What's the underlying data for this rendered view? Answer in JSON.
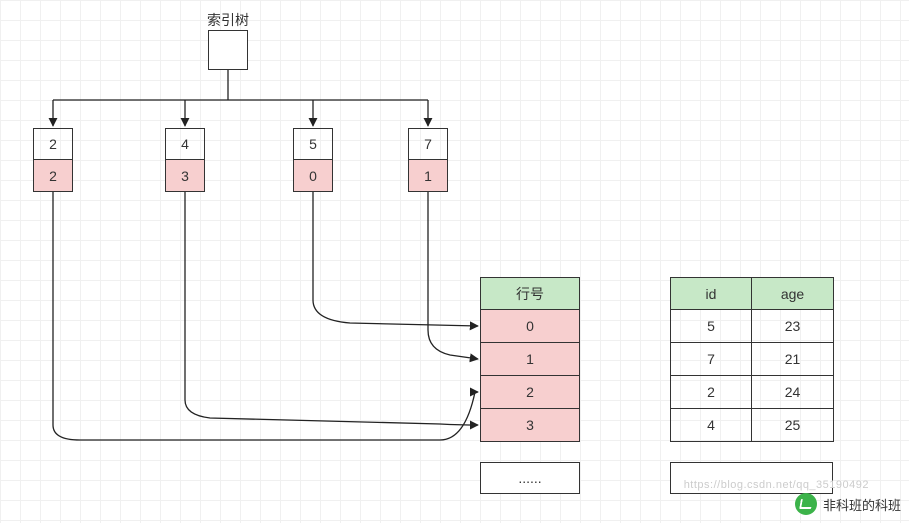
{
  "title": "索引树",
  "tree": {
    "leaves": [
      {
        "key": "2",
        "ptr": "2"
      },
      {
        "key": "4",
        "ptr": "3"
      },
      {
        "key": "5",
        "ptr": "0"
      },
      {
        "key": "7",
        "ptr": "1"
      }
    ]
  },
  "row_table": {
    "header": "行号",
    "rows": [
      "0",
      "1",
      "2",
      "3"
    ],
    "more": "......"
  },
  "data_table": {
    "headers": [
      "id",
      "age"
    ],
    "rows": [
      [
        "5",
        "23"
      ],
      [
        "7",
        "21"
      ],
      [
        "2",
        "24"
      ],
      [
        "4",
        "25"
      ]
    ]
  },
  "watermark": "非科班的科班",
  "faint_text": "https://blog.csdn.net/qq_35190492",
  "colors": {
    "pink": "#f7cfcf",
    "green": "#c7e8c7"
  },
  "chart_data": {
    "type": "table",
    "description": "B-tree-like index mapping id -> row number, with row table and data table",
    "index_leaves": [
      {
        "id": 2,
        "row_no": 2
      },
      {
        "id": 4,
        "row_no": 3
      },
      {
        "id": 5,
        "row_no": 0
      },
      {
        "id": 7,
        "row_no": 1
      }
    ],
    "row_numbers": [
      0,
      1,
      2,
      3
    ],
    "data_rows": [
      {
        "id": 5,
        "age": 23
      },
      {
        "id": 7,
        "age": 21
      },
      {
        "id": 2,
        "age": 24
      },
      {
        "id": 4,
        "age": 25
      }
    ]
  }
}
